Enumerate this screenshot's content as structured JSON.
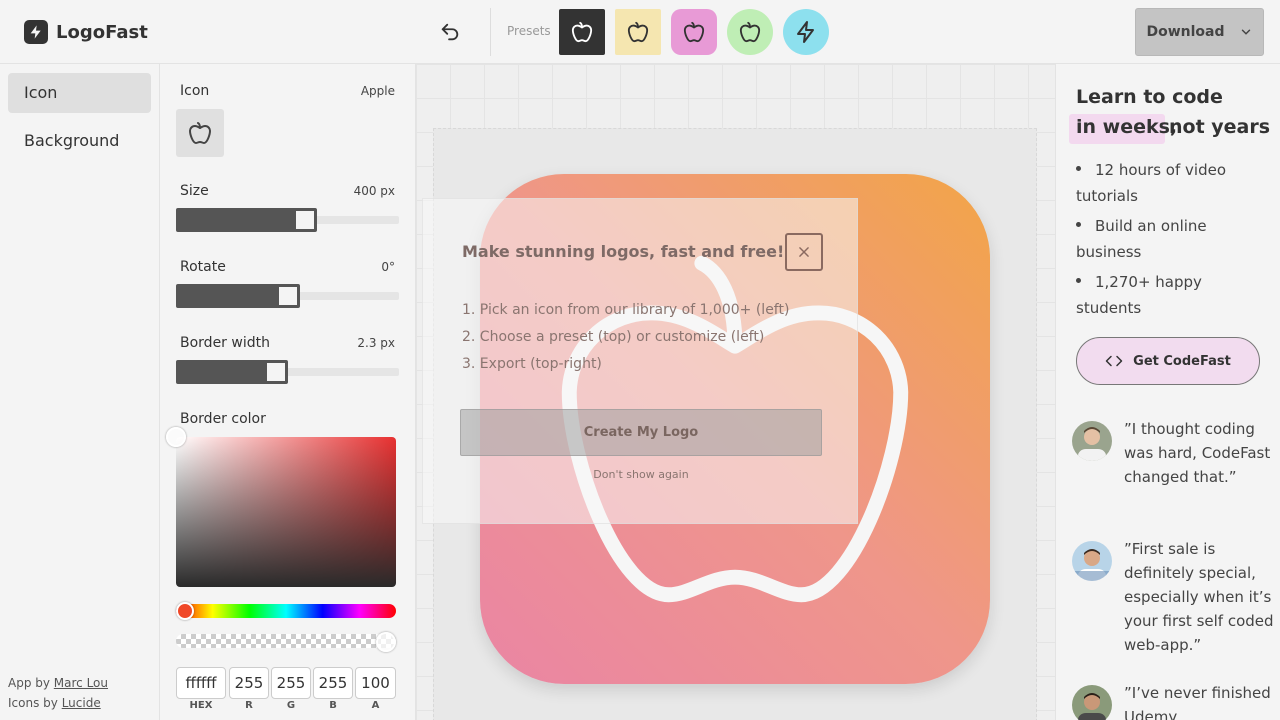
{
  "app": {
    "name": "LogoFast"
  },
  "header": {
    "presets_label": "Presets",
    "download_label": "Download",
    "presets": [
      {
        "bg": "#333333",
        "icon_color": "#ffffff",
        "shape": "square",
        "icon": "apple-icon"
      },
      {
        "bg": "#f5e6b0",
        "icon_color": "#333333",
        "shape": "square",
        "icon": "apple-icon"
      },
      {
        "bg": "#e89ad6",
        "icon_color": "#333333",
        "shape": "rounded",
        "icon": "apple-icon"
      },
      {
        "bg": "#bfeeb5",
        "icon_color": "#333333",
        "shape": "circle",
        "icon": "apple-icon"
      },
      {
        "bg": "#8de0ee",
        "icon_color": "#333333",
        "shape": "circle",
        "icon": "zap-icon"
      }
    ]
  },
  "nav": {
    "items": [
      {
        "label": "Icon",
        "active": true
      },
      {
        "label": "Background",
        "active": false
      }
    ],
    "credits": {
      "app_by_prefix": "App by ",
      "app_by_link": "Marc Lou",
      "icons_by_prefix": "Icons by ",
      "icons_by_link": "Lucide"
    }
  },
  "settings": {
    "icon": {
      "label": "Icon",
      "value": "Apple"
    },
    "size": {
      "label": "Size",
      "value": "400 px",
      "fraction": 0.59
    },
    "rotate": {
      "label": "Rotate",
      "value": "0°",
      "fraction": 0.5
    },
    "border_width": {
      "label": "Border width",
      "value": "2.3 px",
      "fraction": 0.44
    },
    "border_color": {
      "label": "Border color",
      "hex": "ffffff",
      "r": "255",
      "g": "255",
      "b": "255",
      "a": "100",
      "labels": {
        "hex": "HEX",
        "r": "R",
        "g": "G",
        "b": "B",
        "a": "A"
      }
    }
  },
  "canvas": {
    "gradient": [
      "#ea85a4",
      "#ef968a",
      "#f2a547"
    ],
    "icon": "apple-icon",
    "icon_color": "#f6f6f6"
  },
  "modal": {
    "title": "Make stunning logos, fast and free!",
    "steps": [
      "1. Pick an icon from our library of 1,000+ (left)",
      "2. Choose a preset (top) or customize (left)",
      "3. Export (top-right)"
    ],
    "button_label": "Create My Logo",
    "dismiss_label": "Don't show again"
  },
  "promo": {
    "title_line1": "Learn to code",
    "title_highlight": "in weeks,",
    "title_rest": "not years",
    "bullets": [
      "12 hours of video tutorials",
      "Build an online business",
      "1,270+ happy students"
    ],
    "cta_label": "Get CodeFast",
    "testimonials": [
      {
        "quote": "”I thought coding was hard, CodeFast changed that.”"
      },
      {
        "quote": "”First sale is definitely special, especially when it’s your first self coded web-app.”"
      },
      {
        "quote": "”I’ve never finished Udemy"
      }
    ]
  }
}
